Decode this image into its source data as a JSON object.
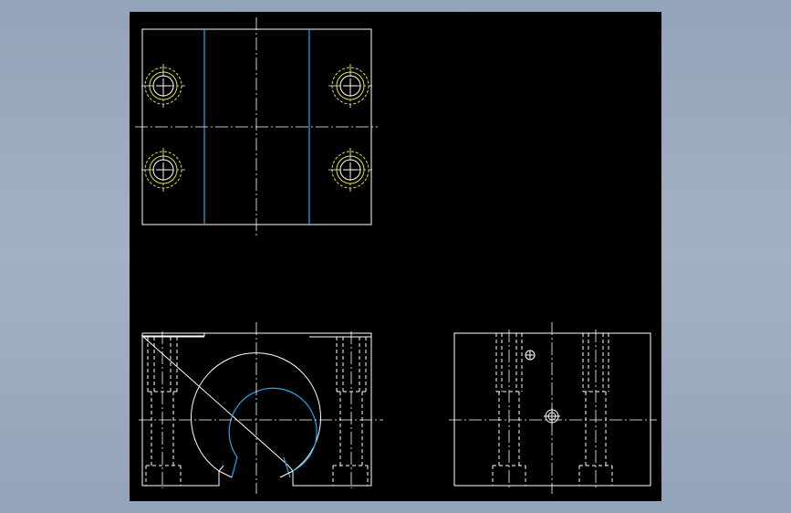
{
  "colors": {
    "background": "#93a3b9",
    "viewport": "#000000",
    "outline": "#ffffff",
    "bore": "#2aa6e8",
    "hole": "#e6e62a"
  },
  "views": [
    "top-view",
    "front-view",
    "side-view"
  ]
}
